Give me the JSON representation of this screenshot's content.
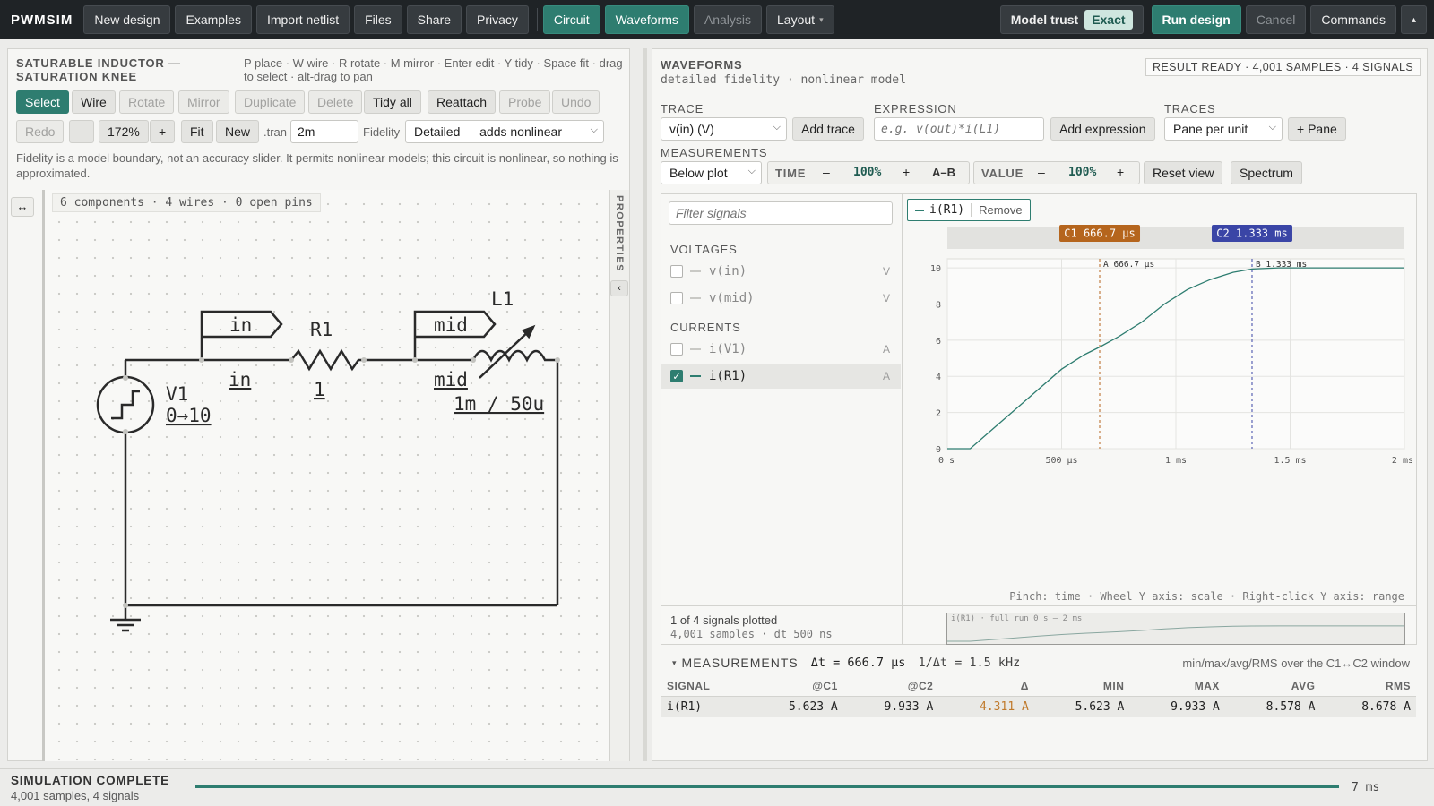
{
  "topbar": {
    "brand": "PWMSIM",
    "buttons": [
      "New design",
      "Examples",
      "Import netlist",
      "Files",
      "Share",
      "Privacy"
    ],
    "views": [
      "Circuit",
      "Waveforms",
      "Analysis",
      "Layout"
    ],
    "layout_chevron": "▾",
    "model_trust_label": "Model trust",
    "model_trust_value": "Exact",
    "run": "Run design",
    "cancel": "Cancel",
    "commands": "Commands",
    "more": "▴"
  },
  "editor": {
    "title_line1": "SATURABLE INDUCTOR —",
    "title_line2": "SATURATION KNEE",
    "hint": "P place · W wire · R rotate · M mirror · Enter edit · Y tidy · Space fit · drag to select · alt-drag to pan",
    "tools": [
      "Select",
      "Wire",
      "Rotate",
      "Mirror",
      "Duplicate",
      "Delete",
      "Tidy all",
      "Reattach",
      "Probe",
      "Undo"
    ],
    "redo": "Redo",
    "zoom_minus": "–",
    "zoom": "172%",
    "zoom_plus": "+",
    "fit": "Fit",
    "new": "New",
    "tran_label": ".tran",
    "tran_value": "2m",
    "fidelity_label": "Fidelity",
    "fidelity_value": "Detailed — adds nonlinear",
    "note": "Fidelity is a model boundary, not an accuracy slider. It permits nonlinear models; this circuit is nonlinear, so nothing is approximated.",
    "collapse_icon": "↔",
    "summary": "6 components · 4 wires · 0 open pins",
    "properties": "PROPERTIES",
    "props_toggle": "‹"
  },
  "schematic": {
    "net_in": "in",
    "net_mid": "mid",
    "r1_name": "R1",
    "r1_value": "1",
    "in_label": "in",
    "mid_label": "mid",
    "l1_name": "L1",
    "l1_value": "1m / 50u",
    "v1_name": "V1",
    "v1_value": "0→10"
  },
  "waveforms": {
    "title": "WAVEFORMS",
    "subtitle": "detailed fidelity · nonlinear model",
    "result": "RESULT READY · 4,001 SAMPLES · 4 SIGNALS",
    "trace_label": "TRACE",
    "trace_value": "v(in) (V)",
    "add_trace": "Add trace",
    "expr_label": "EXPRESSION",
    "expr_placeholder": "e.g. v(out)*i(L1)",
    "add_expr": "Add expression",
    "traces_label": "TRACES",
    "traces_value": "Pane per unit",
    "add_pane": "+ Pane",
    "meas_label": "MEASUREMENTS",
    "meas_value": "Below plot",
    "time_label": "TIME",
    "time_minus": "–",
    "time_zoom": "100%",
    "time_plus": "+",
    "ab": "A–B",
    "value_label": "VALUE",
    "value_minus": "–",
    "value_zoom": "100%",
    "value_plus": "+",
    "reset": "Reset view",
    "spectrum": "Spectrum",
    "filter_placeholder": "Filter signals",
    "voltages": "VOLTAGES",
    "currents": "CURRENTS",
    "signals": [
      {
        "name": "v(in)",
        "unit": "V",
        "checked": false
      },
      {
        "name": "v(mid)",
        "unit": "V",
        "checked": false
      },
      {
        "name": "i(V1)",
        "unit": "A",
        "checked": false
      },
      {
        "name": "i(R1)",
        "unit": "A",
        "checked": true
      }
    ],
    "check": "✓",
    "plotted": "1 of 4 signals plotted",
    "samples_info": "4,001 samples · dt 500 ns",
    "chip_name": "i(R1)",
    "chip_remove": "Remove",
    "cursor1": "C1 666.7 µs",
    "cursor2": "C2 1.333 ms",
    "marker_a": "A 666.7 µs",
    "marker_b": "B 1.333 ms",
    "hint": "Pinch: time · Wheel Y axis: scale · Right-click Y axis: range",
    "overview": "i(R1) · full run 0 s – 2 ms"
  },
  "chart_data": {
    "type": "line",
    "title": "",
    "xlabel": "",
    "ylabel": "",
    "xlim_ms": [
      0,
      2
    ],
    "ylim": [
      0,
      10.5
    ],
    "x_ticks": [
      "0 s",
      "500 µs",
      "1 ms",
      "1.5 ms",
      "2 ms"
    ],
    "x_tick_values_ms": [
      0,
      0.5,
      1,
      1.5,
      2
    ],
    "y_ticks": [
      0,
      2,
      4,
      6,
      8,
      10
    ],
    "cursors_ms": [
      0.6667,
      1.3333
    ],
    "series": [
      {
        "name": "i(R1)",
        "color": "#2e7d70",
        "x_ms": [
          0,
          0.1,
          0.2,
          0.3,
          0.4,
          0.5,
          0.6,
          0.6667,
          0.75,
          0.85,
          0.95,
          1.0,
          1.05,
          1.15,
          1.25,
          1.3333,
          1.45,
          1.6,
          1.8,
          2.0
        ],
        "values": [
          0,
          0,
          1.1,
          2.2,
          3.3,
          4.4,
          5.2,
          5.623,
          6.2,
          7.0,
          8.0,
          8.4,
          8.8,
          9.35,
          9.75,
          9.933,
          10.0,
          10.0,
          10.0,
          10.0
        ]
      }
    ],
    "grid": true,
    "legend": "top-left"
  },
  "measurements": {
    "title": "MEASUREMENTS",
    "toggle": "▾",
    "dt": "Δt = 666.7 µs",
    "inv_dt": "1/Δt = 1.5 kHz",
    "note": "min/max/avg/RMS over the C1↔C2 window",
    "headers": [
      "SIGNAL",
      "@C1",
      "@C2",
      "Δ",
      "MIN",
      "MAX",
      "AVG",
      "RMS"
    ],
    "row": [
      "i(R1)",
      "5.623 A",
      "9.933 A",
      "4.311 A",
      "5.623 A",
      "9.933 A",
      "8.578 A",
      "8.678 A"
    ]
  },
  "status": {
    "title": "SIMULATION COMPLETE",
    "detail": "4,001 samples, 4 signals",
    "time": "7 ms",
    "progress": 1.0
  },
  "colors": {
    "accent": "#2e7d70",
    "cursor1": "#b5651d",
    "cursor2": "#3a45a6",
    "delta": "#c07a2c"
  }
}
